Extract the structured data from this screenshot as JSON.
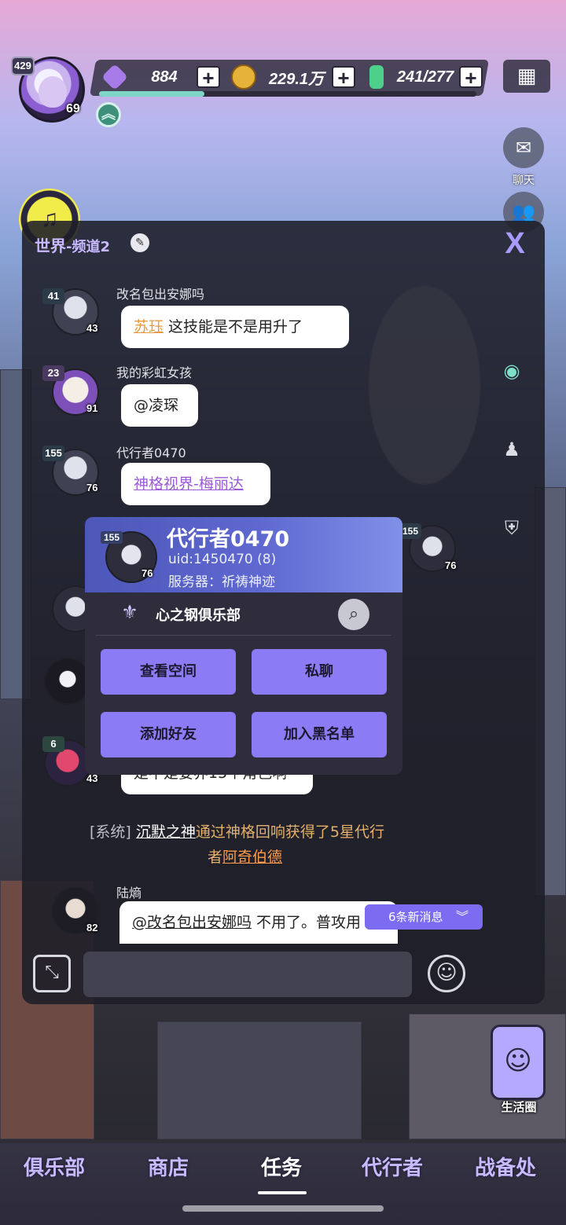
{
  "hud": {
    "avatar_level": "429",
    "avatar_badge": "69",
    "gems": "884",
    "coins": "229.1万",
    "stamina": "241/277",
    "plus": "+",
    "exp_progress": 0.28,
    "colors": {
      "accent": "#8b7bf5",
      "gem": "#a77be8",
      "coin": "#e7b23a",
      "stamina": "#4fd08a"
    }
  },
  "side": {
    "chat_label": "聊天",
    "life_label": "生活圈"
  },
  "chat": {
    "title_main": "世界",
    "title_sub": "-频道2",
    "close": "X",
    "messages": [
      {
        "name": "改名包出安娜吗",
        "level": "41",
        "badge": "43",
        "mention": "苏珏",
        "text": " 这技能是不是用升了"
      },
      {
        "name": "我的彩虹女孩",
        "level": "23",
        "badge": "91",
        "text": "@凌琛"
      },
      {
        "name": "代行者0470",
        "level": "155",
        "badge": "76",
        "link": "神格视界-梅丽达"
      },
      {
        "level": "6",
        "badge": "43",
        "text": "是不是要养15个角色啊"
      },
      {
        "name": "陆熵",
        "badge": "82",
        "mention": "@改名包出安娜吗",
        "text": " 不用了。普攻用"
      }
    ],
    "system": {
      "tag": "[系统]",
      "user": "沉默之神",
      "text1": "通过神格回响获得了5星代行",
      "text2": "者",
      "item": "阿奇伯德"
    },
    "new_messages": "6条新消息"
  },
  "popup": {
    "name": "代行者0470",
    "level": "155",
    "badge": "76",
    "uid": "uid:1450470 (8)",
    "server": "服务器：祈祷神迹",
    "club": "心之钢俱乐部",
    "btn_space": "查看空间",
    "btn_dm": "私聊",
    "btn_add": "添加好友",
    "btn_block": "加入黑名单"
  },
  "right_avatar": {
    "level": "155",
    "badge": "76"
  },
  "nav": {
    "club": "俱乐部",
    "shop": "商店",
    "tasks": "任务",
    "agents": "代行者",
    "war": "战备处"
  }
}
